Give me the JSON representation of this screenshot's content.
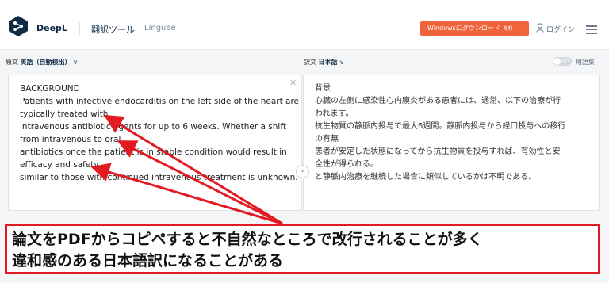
{
  "header": {
    "brand": "DeepL",
    "nav_translate": "翻訳ツール",
    "nav_linguee": "Linguee",
    "download_button": "Windowsにダウンロード",
    "download_badge": "無料",
    "login": "ログイン",
    "brand_color": "#0f2b46",
    "accent_color": "#f0643c"
  },
  "source": {
    "label": "原文",
    "language": "英語（自動検出）",
    "lines": [
      "BACKGROUND",
      "Patients with ",
      "infective",
      " endocarditis on the left side of the heart are",
      "typically treated with",
      "intravenous antibiotic agents for up to 6 weeks. Whether a shift",
      "from intravenous to oral",
      "antibiotics once the patient is in stable condition would result in",
      "efficacy and safety",
      "similar to those with continued intravenous treatment is unknown."
    ]
  },
  "target": {
    "label": "訳文",
    "language": "日本語",
    "toggle_state": "OFF",
    "glossary": "用語集",
    "lines": [
      "背景",
      "心臓の左側に感染性心内膜炎がある患者には、通常、以下の治療が行",
      "われます。",
      "抗生物質の静脈内投与で最大6週間。静脈内投与から経口投与への移行",
      "の有無",
      "患者が安定した状態になってから抗生物質を投与すれば、有効性と安",
      "全性が得られる。",
      "と静脈内治療を継続した場合に類似しているかは不明である。"
    ]
  },
  "callout": {
    "line1": "論文をPDFからコピペすると不自然なところで改行されることが多く",
    "line2": "違和感のある日本語訳になることがある",
    "border_color": "#e21b22"
  },
  "icons": {
    "logo": "deepl-logo-icon",
    "user": "user-icon",
    "menu": "hamburger-menu-icon",
    "close": "clear-text-icon",
    "swap": "chevron-right-icon",
    "chevron": "chevron-down-icon"
  }
}
